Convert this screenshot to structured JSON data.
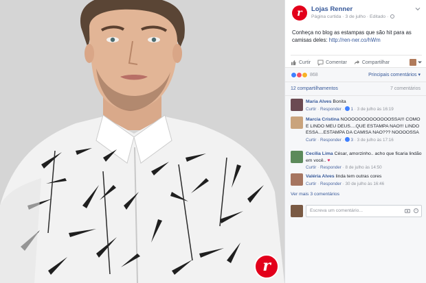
{
  "photo": {
    "badge_letter": "r",
    "bg_color": "#d6d6d6"
  },
  "post": {
    "page_name": "Lojas Renner",
    "logo_letter": "r",
    "meta": "Página curtida · 3 de julho · Editado ·",
    "text": "Conheça no blog as estampas que são hit para as camisas deles: ",
    "link": "http://ren-ner.co/hWm",
    "brand_color": "#e3001b"
  },
  "actions": {
    "like": "Curtir",
    "comment": "Comentar",
    "share": "Compartilhar"
  },
  "reactions": {
    "count": "868",
    "sort": "Principais comentários ▾"
  },
  "shares": {
    "left": "12 compartilhamentos",
    "right": "7 comentários"
  },
  "comments": [
    {
      "author": "Maria Alves",
      "text": "Bonita",
      "like": "Curtir",
      "reply": "Responder",
      "likes": "1",
      "time": "3 de julho às 16:19"
    },
    {
      "author": "Marcia Cristina",
      "text": "NOOOOOOOOOOOOOSSA!!! COMO E LINDO MEU DEUS....QUE ESTAMPA NAO!!! LINDO ESSA....ESTAMPA DA CAMISA NAO??? NOOOOSSA",
      "like": "Curtir",
      "reply": "Responder",
      "likes": "3",
      "time": "3 de julho às 17:16"
    },
    {
      "author": "Cecília Lima",
      "text": "César, amorzinho.. acho que ficaria lindão em você..",
      "like": "Curtir",
      "reply": "Responder",
      "time": "8 de julho às 14:50"
    },
    {
      "author": "Valéria Alves",
      "text": "linda tem outras cores",
      "like": "Curtir",
      "reply": "Responder",
      "time": "30 de julho às 16:46"
    }
  ],
  "more_comments": "Ver mais 3 comentários",
  "write": {
    "placeholder": "Escreva um comentário..."
  }
}
